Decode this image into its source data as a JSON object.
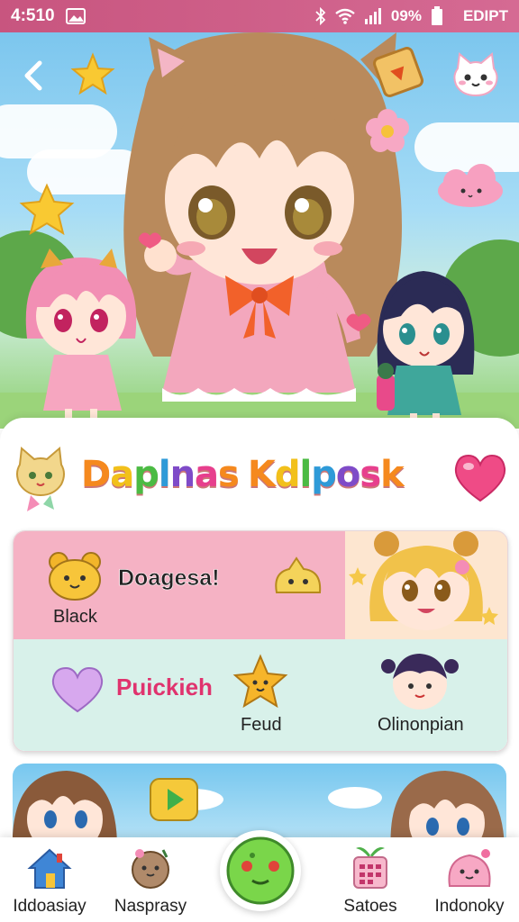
{
  "status_bar": {
    "time": "4:510",
    "battery_text": "09%",
    "carrier": "EDIPT",
    "icons": [
      "image-icon",
      "bluetooth-icon",
      "wifi-icon",
      "signal-icon",
      "battery-icon"
    ]
  },
  "hero": {
    "back_icon": "chevron-left-icon",
    "star_icon": "star-icon",
    "cat_icon": "cat-face-icon"
  },
  "main": {
    "title": "Daplnas Kdlposk",
    "title_colors": [
      "#f5891e",
      "#f2c01b",
      "#4bbb43",
      "#2e9ad8",
      "#7f4bc8",
      "#e73f8d",
      "#f5891e"
    ],
    "heart_icon": "heart-icon",
    "menu": {
      "row1": {
        "label": "Doagesa!",
        "sub": "Black"
      },
      "row2": {
        "label": "Puickieh",
        "sub": "Feud",
        "caption": "Olinonpian"
      }
    },
    "banner": {
      "play_icon": "play-icon"
    }
  },
  "bottom_nav": {
    "items": [
      {
        "label": "Iddoasiay",
        "icon": "home-icon"
      },
      {
        "label": "Nasprasy",
        "icon": "cookie-icon"
      },
      {
        "label": "Satoes",
        "icon": "calendar-icon"
      },
      {
        "label": "Indonoky",
        "icon": "pink-slime-icon"
      }
    ],
    "center_icon": "green-slime-icon"
  },
  "colors": {
    "status_bar": "#c8557f",
    "pink_row": "#f5b2c4",
    "mint_row": "#d8f1ea",
    "accent_pink": "#e0336e"
  }
}
